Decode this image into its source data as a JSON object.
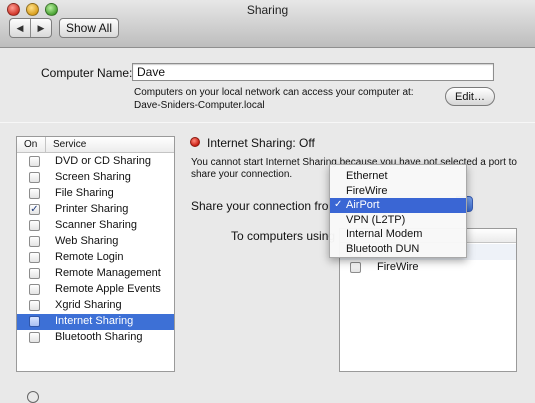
{
  "window": {
    "title": "Sharing"
  },
  "toolbar": {
    "back": "◀",
    "forward": "▶",
    "show_all": "Show All"
  },
  "computer_name": {
    "label": "Computer Name:",
    "value": "Dave",
    "description": "Computers on your local network can access your computer at: Dave-Sniders-Computer.local",
    "edit_button": "Edit…"
  },
  "services": {
    "header_on": "On",
    "header_service": "Service",
    "items": [
      {
        "label": "DVD or CD Sharing",
        "checked": false
      },
      {
        "label": "Screen Sharing",
        "checked": false
      },
      {
        "label": "File Sharing",
        "checked": false
      },
      {
        "label": "Printer Sharing",
        "checked": true
      },
      {
        "label": "Scanner Sharing",
        "checked": false
      },
      {
        "label": "Web Sharing",
        "checked": false
      },
      {
        "label": "Remote Login",
        "checked": false
      },
      {
        "label": "Remote Management",
        "checked": false
      },
      {
        "label": "Remote Apple Events",
        "checked": false
      },
      {
        "label": "Xgrid Sharing",
        "checked": false
      },
      {
        "label": "Internet Sharing",
        "checked": false,
        "selected": true
      },
      {
        "label": "Bluetooth Sharing",
        "checked": false
      }
    ]
  },
  "internet_sharing": {
    "status": "Internet Sharing: Off",
    "status_color": "#d0241a",
    "notice": "You cannot start Internet Sharing because you have not selected a port to share your connection.",
    "share_from_label": "Share your connection from",
    "to_computers_label": "To computers using",
    "ports": [
      {
        "label": "",
        "checked": false
      },
      {
        "label": "FireWire",
        "checked": false
      }
    ]
  },
  "dropdown": {
    "options": [
      "Ethernet",
      "FireWire",
      "AirPort",
      "VPN (L2TP)",
      "Internal Modem",
      "Bluetooth DUN"
    ],
    "selected": "AirPort",
    "check_glyph": "✓"
  },
  "colors": {
    "selection": "#3d70d6"
  }
}
